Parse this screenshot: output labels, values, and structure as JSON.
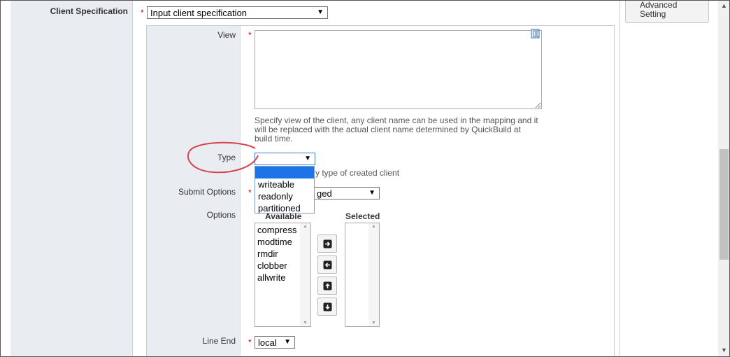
{
  "form": {
    "client_spec_label": "Client Specification",
    "client_spec_value": "Input client specification",
    "view_label": "View",
    "view_value": "",
    "view_hint": [
      "Specify view of the client, any client name can be used in the mapping and it",
      "will be replaced with the actual client name determined by QuickBuild at",
      "build time."
    ],
    "type_label": "Type",
    "type_value": "",
    "type_hint_partial": "y type of created client",
    "type_options": [
      "",
      "writeable",
      "readonly",
      "partitioned"
    ],
    "submit_label": "Submit Options",
    "submit_value_partial": "ged",
    "options_label": "Options",
    "available_label": "Available",
    "selected_label": "Selected",
    "available_items": [
      "compress",
      "modtime",
      "rmdir",
      "clobber",
      "allwrite"
    ],
    "selected_items": [],
    "line_end_label": "Line End",
    "line_end_value": "local"
  },
  "sidebar": {
    "advanced_setting_label_line1": "Advanced",
    "advanced_setting_label_line2": "Setting"
  },
  "icons": {
    "dropdown_arrow": "▼",
    "scroll_up": "▲",
    "scroll_down": "▼"
  },
  "colors": {
    "required": "#d0021b",
    "highlight": "#1e73e8",
    "annotation": "#d9434b"
  }
}
